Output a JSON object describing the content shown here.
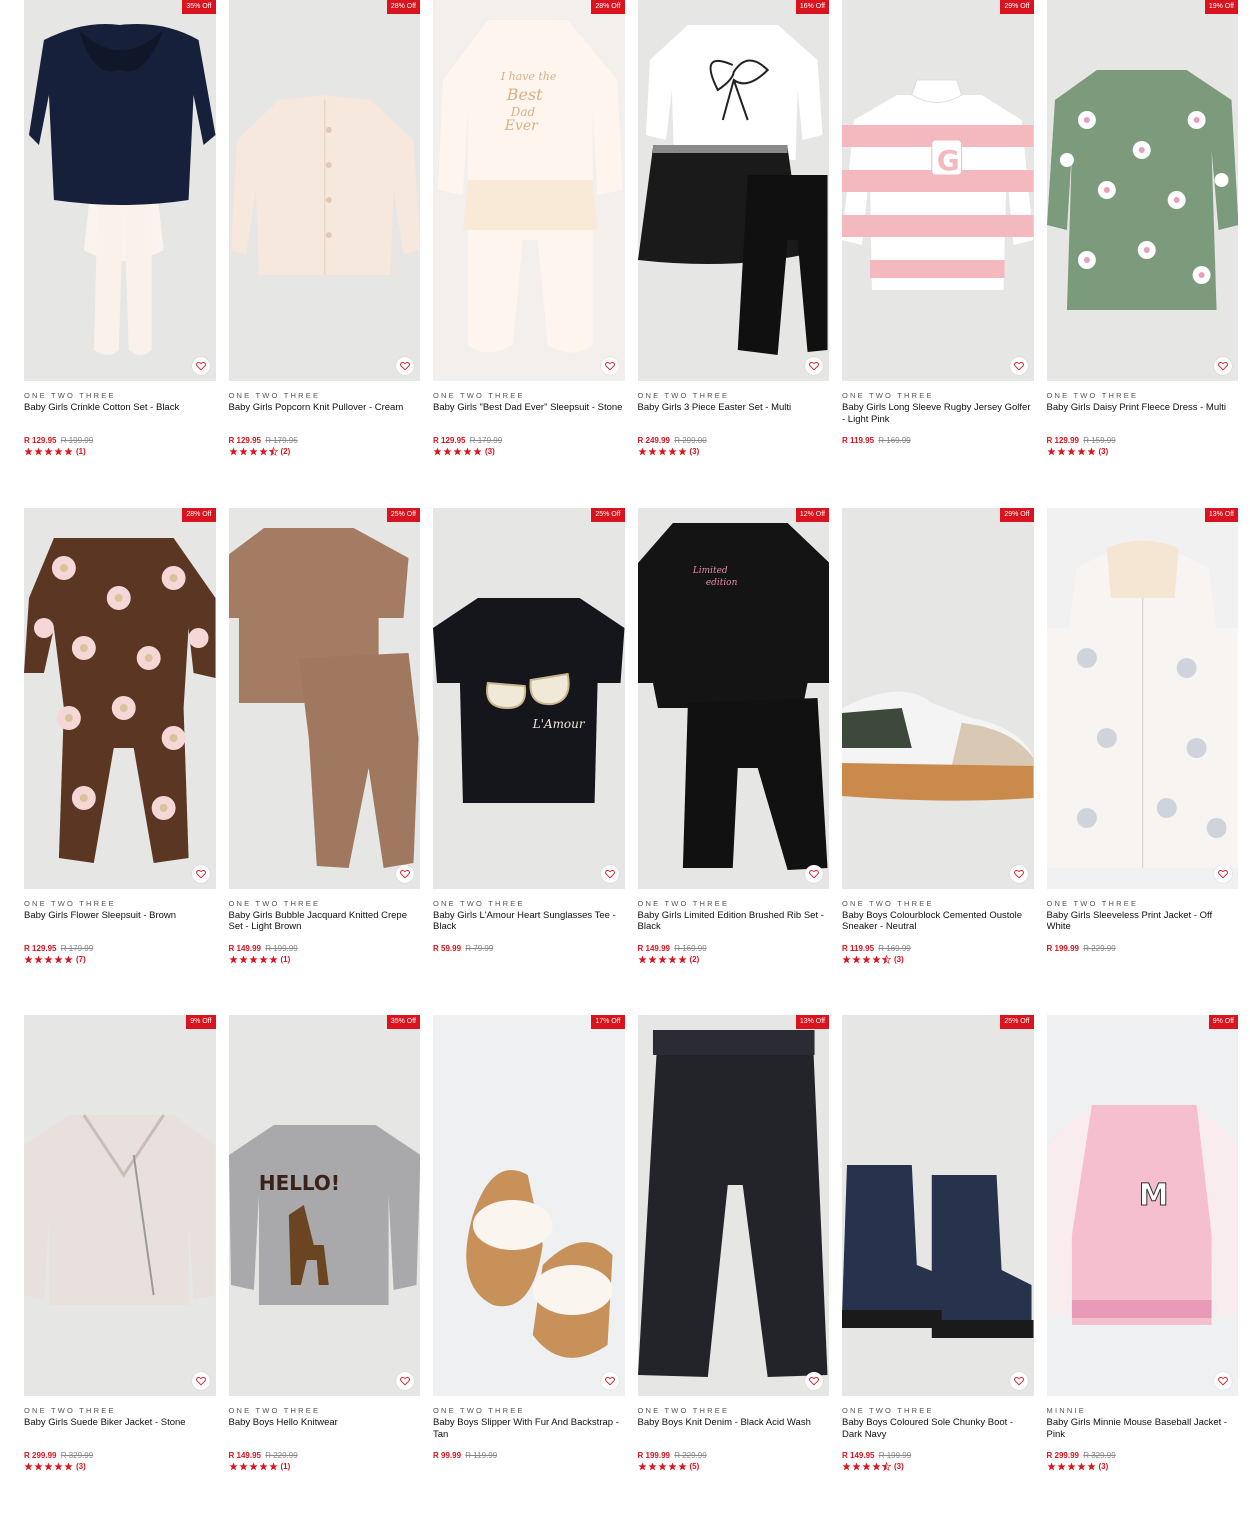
{
  "theme": {
    "accent": "#d9141f",
    "tile_bg": "#e6e6e4"
  },
  "products": [
    {
      "badge": "35% Off",
      "brand": "ONE TWO THREE",
      "title": "Baby Girls Crinkle Cotton Set - Black",
      "price": "R 129.95",
      "was": "R 199.99",
      "rating": 5,
      "count": "(1)",
      "art": "set-black"
    },
    {
      "badge": "28% Off",
      "brand": "ONE TWO THREE",
      "title": "Baby Girls Popcorn Knit Pullover - Cream",
      "price": "R 129.95",
      "was": "R 179.95",
      "rating": 4.5,
      "count": "(2)",
      "art": "cardigan-cream"
    },
    {
      "badge": "28% Off",
      "brand": "ONE TWO THREE",
      "title": "Baby Girls \"Best Dad Ever\" Sleepsuit - Stone",
      "price": "R 129.95",
      "was": "R 179.99",
      "rating": 5,
      "count": "(3)",
      "art": "sleepsuit-stone"
    },
    {
      "badge": "16% Off",
      "brand": "ONE TWO THREE",
      "title": "Baby Girls 3 Piece Easter Set - Multi",
      "price": "R 249.99",
      "was": "R 299.00",
      "rating": 5,
      "count": "(3)",
      "art": "easter-set"
    },
    {
      "badge": "29% Off",
      "brand": "ONE TWO THREE",
      "title": "Baby Girls Long Sleeve Rugby Jersey Golfer - Light Pink",
      "price": "R 119.95",
      "was": "R 169.99",
      "rating": 0,
      "count": "",
      "art": "rugby-pink"
    },
    {
      "badge": "19% Off",
      "brand": "ONE TWO THREE",
      "title": "Baby Girls Daisy Print Fleece Dress - Multi",
      "price": "R 129.99",
      "was": "R 159.99",
      "rating": 5,
      "count": "(3)",
      "art": "daisy-dress"
    },
    {
      "badge": "28% Off",
      "brand": "ONE TWO THREE",
      "title": "Baby Girls Flower Sleepsuit - Brown",
      "price": "R 129.95",
      "was": "R 179.99",
      "rating": 5,
      "count": "(7)",
      "art": "flower-sleepsuit"
    },
    {
      "badge": "25% Off",
      "brand": "ONE TWO THREE",
      "title": "Baby Girls Bubble Jacquard Knitted Crepe Set - Light Brown",
      "price": "R 149.99",
      "was": "R 199.99",
      "rating": 5,
      "count": "(1)",
      "art": "brown-set"
    },
    {
      "badge": "25% Off",
      "brand": "ONE TWO THREE",
      "title": "Baby Girls L'Amour Heart Sunglasses Tee - Black",
      "price": "R 59.99",
      "was": "R 79.99",
      "rating": 0,
      "count": "",
      "art": "black-tee"
    },
    {
      "badge": "12% Off",
      "brand": "ONE TWO THREE",
      "title": "Baby Girls Limited Edition Brushed Rib Set - Black",
      "price": "R 149.99",
      "was": "R 169.99",
      "rating": 5,
      "count": "(2)",
      "art": "black-rib-set"
    },
    {
      "badge": "29% Off",
      "brand": "ONE TWO THREE",
      "title": "Baby Boys Colourblock Cemented Oustole Sneaker - Neutral",
      "price": "R 119.95",
      "was": "R 169.99",
      "rating": 4.5,
      "count": "(3)",
      "art": "sneaker"
    },
    {
      "badge": "13% Off",
      "brand": "ONE TWO THREE",
      "title": "Baby Girls Sleeveless Print Jacket - Off White",
      "price": "R 199.99",
      "was": "R 229.99",
      "rating": 0,
      "count": "",
      "art": "gilet"
    },
    {
      "badge": "9% Off",
      "brand": "ONE TWO THREE",
      "title": "Baby Girls Suede Biker Jacket - Stone",
      "price": "R 299.99",
      "was": "R 329.99",
      "rating": 5,
      "count": "(3)",
      "art": "biker"
    },
    {
      "badge": "35% Off",
      "brand": "ONE TWO THREE",
      "title": "Baby Boys Hello Knitwear",
      "price": "R 149.95",
      "was": "R 229.99",
      "rating": 5,
      "count": "(1)",
      "art": "hello-knit"
    },
    {
      "badge": "17% Off",
      "brand": "ONE TWO THREE",
      "title": "Baby Boys Slipper With Fur And Backstrap - Tan",
      "price": "R 99.99",
      "was": "R 119.99",
      "rating": 0,
      "count": "",
      "art": "slippers"
    },
    {
      "badge": "13% Off",
      "brand": "ONE TWO THREE",
      "title": "Baby Boys Knit Denim - Black Acid Wash",
      "price": "R 199.99",
      "was": "R 229.99",
      "rating": 5,
      "count": "(5)",
      "art": "denim"
    },
    {
      "badge": "25% Off",
      "brand": "ONE TWO THREE",
      "title": "Baby Boys Coloured Sole Chunky Boot - Dark Navy",
      "price": "R 149.95",
      "was": "R 199.99",
      "rating": 4.5,
      "count": "(3)",
      "art": "boots"
    },
    {
      "badge": "9% Off",
      "brand": "MINNIE",
      "title": "Baby Girls Minnie Mouse Baseball Jacket - Pink",
      "price": "R 299.99",
      "was": "R 329.99",
      "rating": 5,
      "count": "(3)",
      "art": "minnie-jacket"
    }
  ]
}
